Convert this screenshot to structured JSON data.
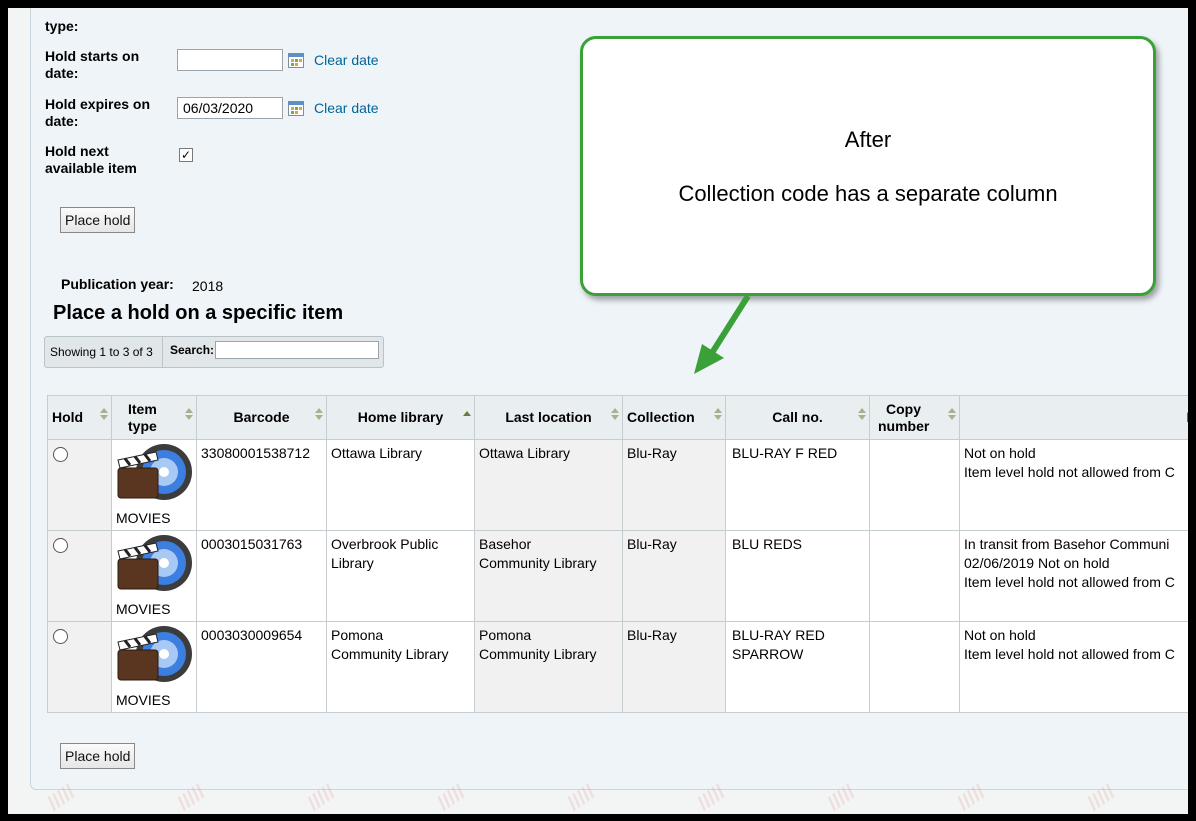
{
  "form": {
    "type_label": "type:",
    "hold_starts_label_1": "Hold starts on",
    "hold_starts_label_2": "date:",
    "hold_starts_value": "",
    "hold_expires_label_1": "Hold expires on",
    "hold_expires_label_2": "date:",
    "hold_expires_value": "06/03/2020",
    "clear_date": "Clear date",
    "next_available_label_1": "Hold next",
    "next_available_label_2": "available item",
    "next_available_checked": "✓",
    "place_hold": "Place hold"
  },
  "publication": {
    "label": "Publication year:",
    "value": "2018"
  },
  "section_title": "Place a hold on a specific item",
  "datatable": {
    "info": "Showing 1 to 3 of 3",
    "search_label": "Search:"
  },
  "table": {
    "headers": {
      "hold": "Hold",
      "item_type_1": "Item",
      "item_type_2": "type",
      "barcode": "Barcode",
      "home_library": "Home library",
      "last_location": "Last location",
      "collection": "Collection",
      "call_no": "Call no.",
      "copy_number_1": "Copy",
      "copy_number_2": "number",
      "info": "In"
    },
    "rows": [
      {
        "item_type": "MOVIES",
        "barcode": "33080001538712",
        "home_library": [
          "Ottawa Library"
        ],
        "last_location": [
          "Ottawa Library"
        ],
        "collection": "Blu-Ray",
        "call_no": [
          "BLU-RAY F RED"
        ],
        "copy_number": "",
        "info": [
          "Not on hold",
          "Item level hold not allowed from C"
        ]
      },
      {
        "item_type": "MOVIES",
        "barcode": "0003015031763",
        "home_library": [
          "Overbrook Public",
          "Library"
        ],
        "last_location": [
          "Basehor",
          "Community Library"
        ],
        "collection": "Blu-Ray",
        "call_no": [
          "BLU REDS"
        ],
        "copy_number": "",
        "info": [
          "In transit from Basehor Communi",
          "02/06/2019 Not on hold",
          "Item level hold not allowed from C"
        ]
      },
      {
        "item_type": "MOVIES",
        "barcode": "0003030009654",
        "home_library": [
          "Pomona",
          "Community Library"
        ],
        "last_location": [
          "Pomona",
          "Community Library"
        ],
        "collection": "Blu-Ray",
        "call_no": [
          "BLU-RAY RED",
          "SPARROW"
        ],
        "copy_number": "",
        "info": [
          "Not on hold",
          "Item level hold not allowed from C"
        ]
      }
    ]
  },
  "callout": {
    "line1": "After",
    "line2": "Collection code has a separate column"
  },
  "colors": {
    "callout_border": "#3aa138",
    "arrow": "#3aa138",
    "link": "#00659b"
  }
}
